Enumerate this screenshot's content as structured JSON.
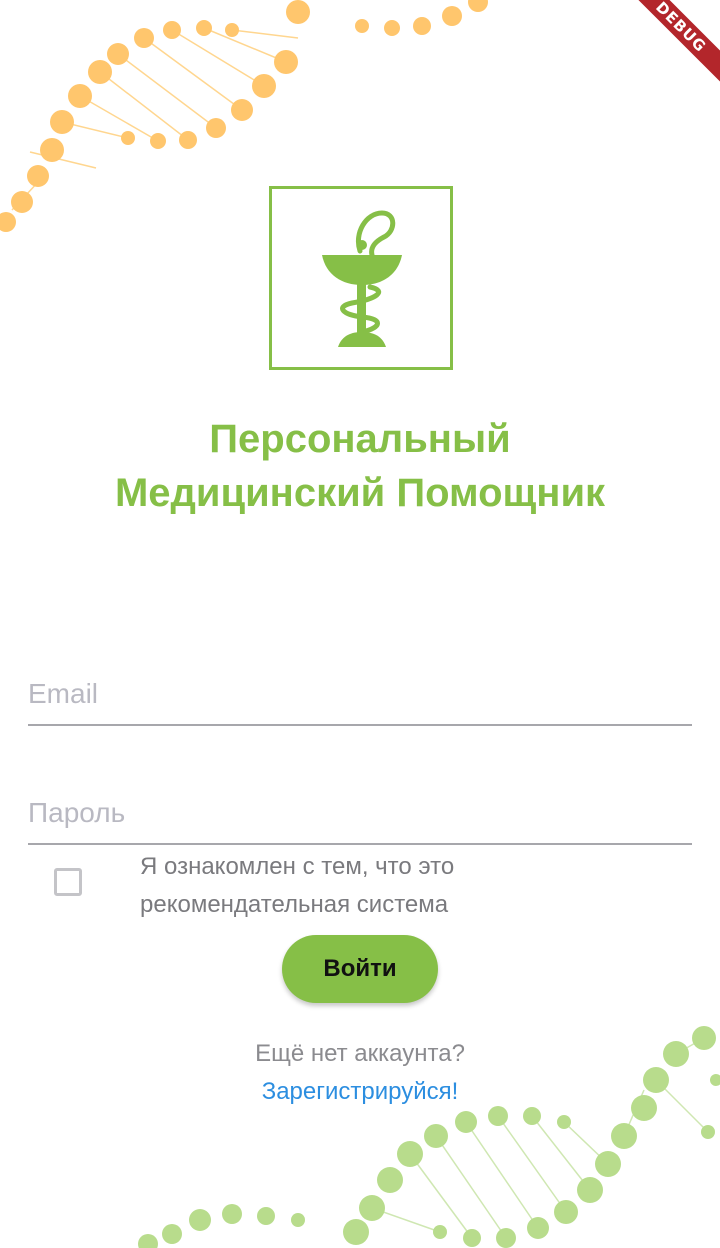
{
  "app": {
    "debug_badge": "DEBUG",
    "title_line1": "Персональный",
    "title_line2": "Медицинский Помощник"
  },
  "form": {
    "email_placeholder": "Email",
    "email_value": "",
    "password_placeholder": "Пароль",
    "password_value": "",
    "agreement_checked": false,
    "agreement_text": "Я ознакомлен с тем, что это рекомендательная система",
    "login_label": "Войти"
  },
  "footer": {
    "no_account_text": "Ещё нет аккаунта?",
    "register_label": "Зарегистрируйся!"
  },
  "colors": {
    "brand_green": "#86bf47",
    "dna_orange": "#ffc66d",
    "dna_green": "#b8dc8c",
    "link_blue": "#2c8ee0",
    "debug_red": "#b3262b"
  },
  "icons": {
    "logo": "bowl-of-hygieia-icon"
  }
}
